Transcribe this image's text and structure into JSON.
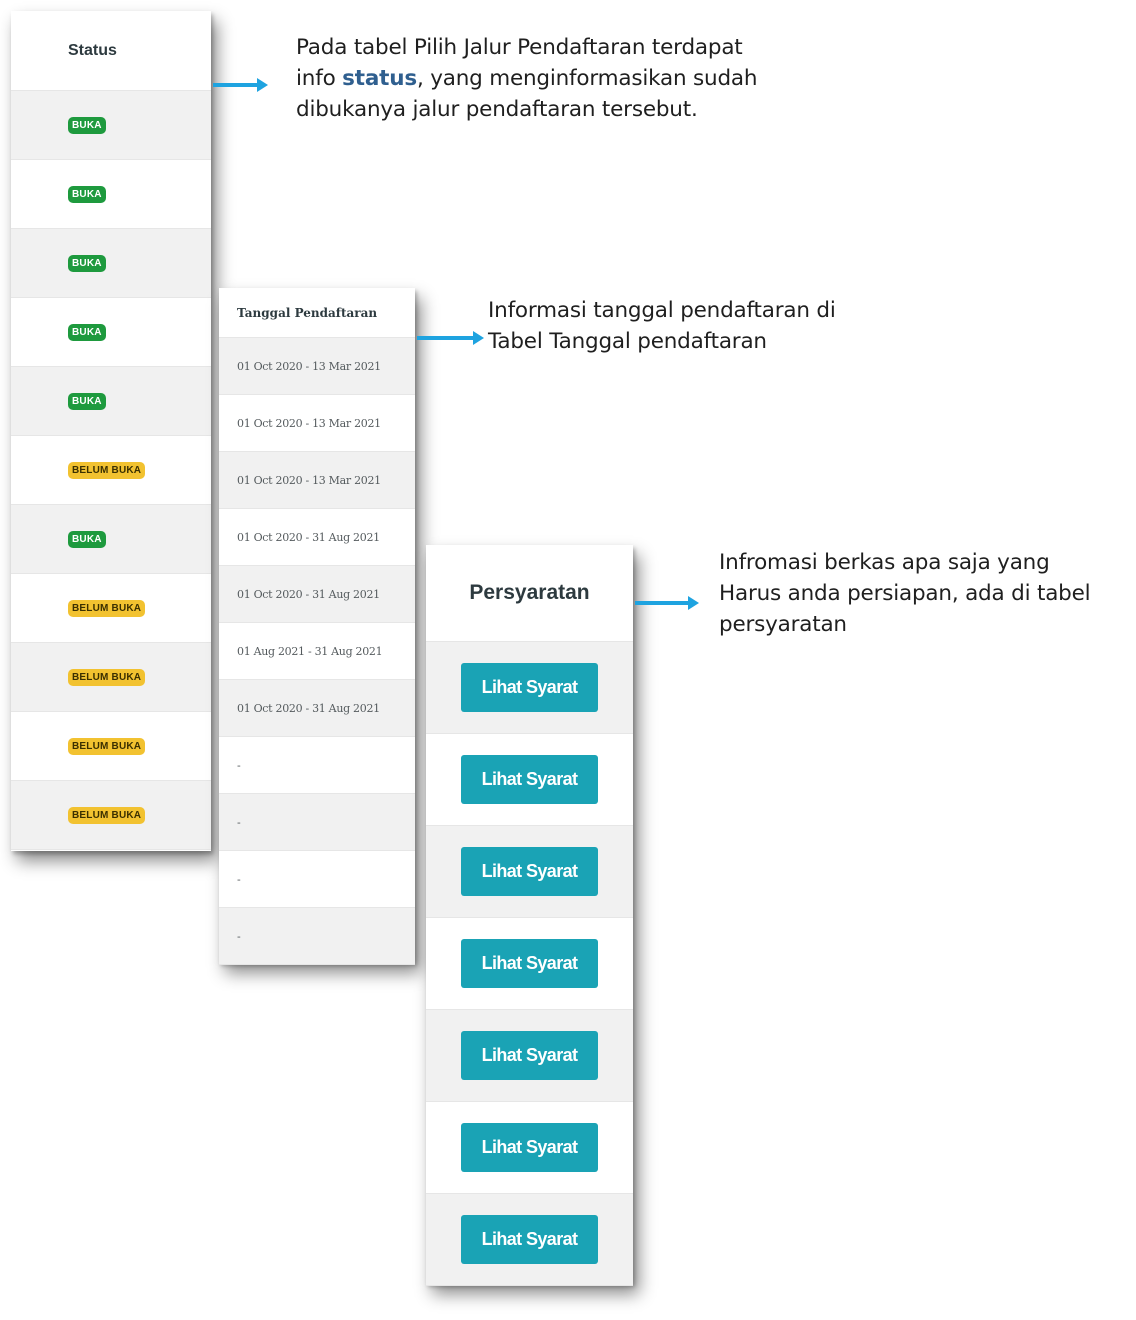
{
  "status_table": {
    "header": "Status",
    "rows": [
      "BUKA",
      "BUKA",
      "BUKA",
      "BUKA",
      "BUKA",
      "BELUM BUKA",
      "BUKA",
      "BELUM BUKA",
      "BELUM BUKA",
      "BELUM BUKA",
      "BELUM BUKA"
    ]
  },
  "date_table": {
    "header": "Tanggal Pendaftaran",
    "rows": [
      "01 Oct 2020 - 13 Mar 2021",
      "01 Oct 2020 - 13 Mar 2021",
      "01 Oct 2020 - 13 Mar 2021",
      "01 Oct 2020 - 31 Aug 2021",
      "01 Oct 2020 - 31 Aug 2021",
      "01 Aug 2021 - 31 Aug 2021",
      "01 Oct 2020 - 31 Aug 2021",
      "-",
      "-",
      "-",
      "-"
    ]
  },
  "requirement_table": {
    "header": "Persyaratan",
    "button_label": "Lihat Syarat",
    "rows": [
      "Lihat Syarat",
      "Lihat Syarat",
      "Lihat Syarat",
      "Lihat Syarat",
      "Lihat Syarat",
      "Lihat Syarat",
      "Lihat Syarat"
    ]
  },
  "annotations": {
    "status": {
      "line1": "Pada tabel Pilih Jalur Pendaftaran terdapat",
      "line2_prefix": "info ",
      "line2_highlight": "status",
      "line2_suffix": ", yang menginformasikan sudah",
      "line3": "dibukanya jalur pendaftaran tersebut."
    },
    "date": {
      "line1": "Informasi tanggal pendaftaran di",
      "line2": "Tabel Tanggal pendaftaran"
    },
    "requirement": {
      "line1": "Infromasi berkas apa saja yang",
      "line2": "Harus anda persiapan, ada di tabel",
      "line3": "persyaratan"
    }
  },
  "colors": {
    "badge_open": "#1e9a3e",
    "badge_closed": "#f2c230",
    "button": "#1aa3b5",
    "arrow": "#1ea3e0",
    "highlight_text": "#2f5f8f"
  }
}
